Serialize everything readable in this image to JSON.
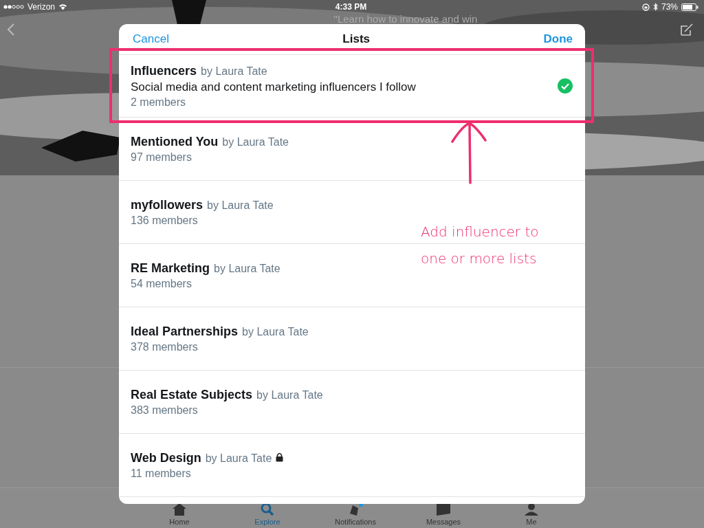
{
  "status_bar": {
    "carrier": "Verizon",
    "time": "4:33 PM",
    "battery": "73%"
  },
  "header": {
    "quote": "\"Learn how to innovate and win"
  },
  "dialog": {
    "title": "Lists",
    "cancel": "Cancel",
    "done": "Done",
    "lists": [
      {
        "name": "Influencers",
        "owner": "by Laura Tate",
        "description": "Social media and content marketing influencers I follow",
        "members": "2 members",
        "selected": true,
        "locked": false
      },
      {
        "name": "Mentioned You",
        "owner": "by Laura Tate",
        "members": "97 members",
        "selected": false,
        "locked": false
      },
      {
        "name": "myfollowers",
        "owner": "by Laura Tate",
        "members": "136 members",
        "selected": false,
        "locked": false
      },
      {
        "name": "RE Marketing",
        "owner": "by Laura Tate",
        "members": "54 members",
        "selected": false,
        "locked": false
      },
      {
        "name": "Ideal Partnerships",
        "owner": "by Laura Tate",
        "members": "378 members",
        "selected": false,
        "locked": false
      },
      {
        "name": "Real Estate Subjects",
        "owner": "by Laura Tate",
        "members": "383 members",
        "selected": false,
        "locked": false
      },
      {
        "name": "Web Design",
        "owner": "by Laura Tate",
        "members": "11 members",
        "selected": false,
        "locked": true
      }
    ]
  },
  "tab_bar": [
    {
      "label": "Home",
      "kind": "home",
      "selected": false
    },
    {
      "label": "Explore",
      "kind": "explore",
      "selected": true
    },
    {
      "label": "Notifications",
      "kind": "notifications",
      "selected": false
    },
    {
      "label": "Messages",
      "kind": "messages",
      "selected": false
    },
    {
      "label": "Me",
      "kind": "me",
      "selected": false
    }
  ],
  "annotation": {
    "lines": [
      "Add influencer to",
      "one or more lists"
    ]
  }
}
